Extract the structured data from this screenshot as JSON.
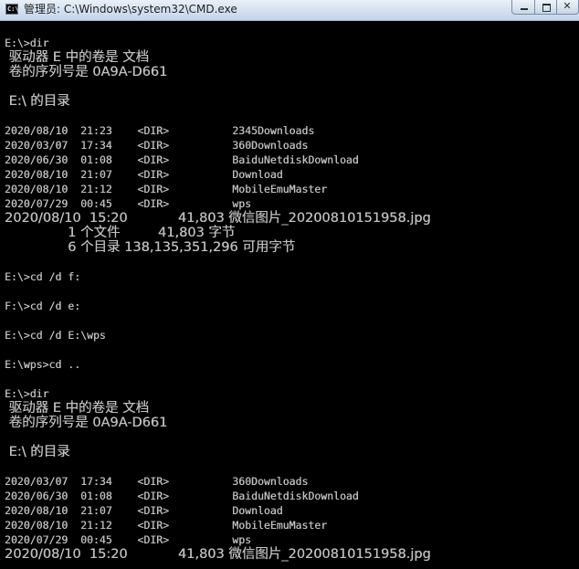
{
  "window": {
    "title": "管理员: C:\\Windows\\system32\\CMD.exe",
    "icon_name": "cmd-icon",
    "icon_label": "C:\\"
  },
  "colors": {
    "console_background": "#000000",
    "console_text": "#c0c0c0",
    "titlebar": "#d4e0ef"
  },
  "console": {
    "lines": [
      "E:\\>dir",
      " 驱动器 E 中的卷是 文档",
      " 卷的序列号是 0A9A-D661",
      " E:\\ 的目录",
      "2020/08/10  21:23    <DIR>          2345Downloads",
      "2020/03/07  17:34    <DIR>          360Downloads",
      "2020/06/30  01:08    <DIR>          BaiduNetdiskDownload",
      "2020/08/10  21:07    <DIR>          Download",
      "2020/08/10  21:12    <DIR>          MobileEmuMaster",
      "2020/07/29  00:45    <DIR>          wps",
      "2020/08/10  15:20            41,803 微信图片_20200810151958.jpg",
      "               1 个文件         41,803 字节",
      "               6 个目录 138,135,351,296 可用字节",
      "E:\\>cd /d f:",
      "F:\\>cd /d e:",
      "E:\\>cd /d E:\\wps",
      "E:\\wps>cd ..",
      "E:\\>dir",
      " 驱动器 E 中的卷是 文档",
      " 卷的序列号是 0A9A-D661",
      " E:\\ 的目录",
      "2020/03/07  17:34    <DIR>          360Downloads",
      "2020/06/30  01:08    <DIR>          BaiduNetdiskDownload",
      "2020/08/10  21:07    <DIR>          Download",
      "2020/08/10  21:12    <DIR>          MobileEmuMaster",
      "2020/07/29  00:45    <DIR>          wps",
      "2020/08/10  15:20            41,803 微信图片_20200810151958.jpg"
    ]
  }
}
